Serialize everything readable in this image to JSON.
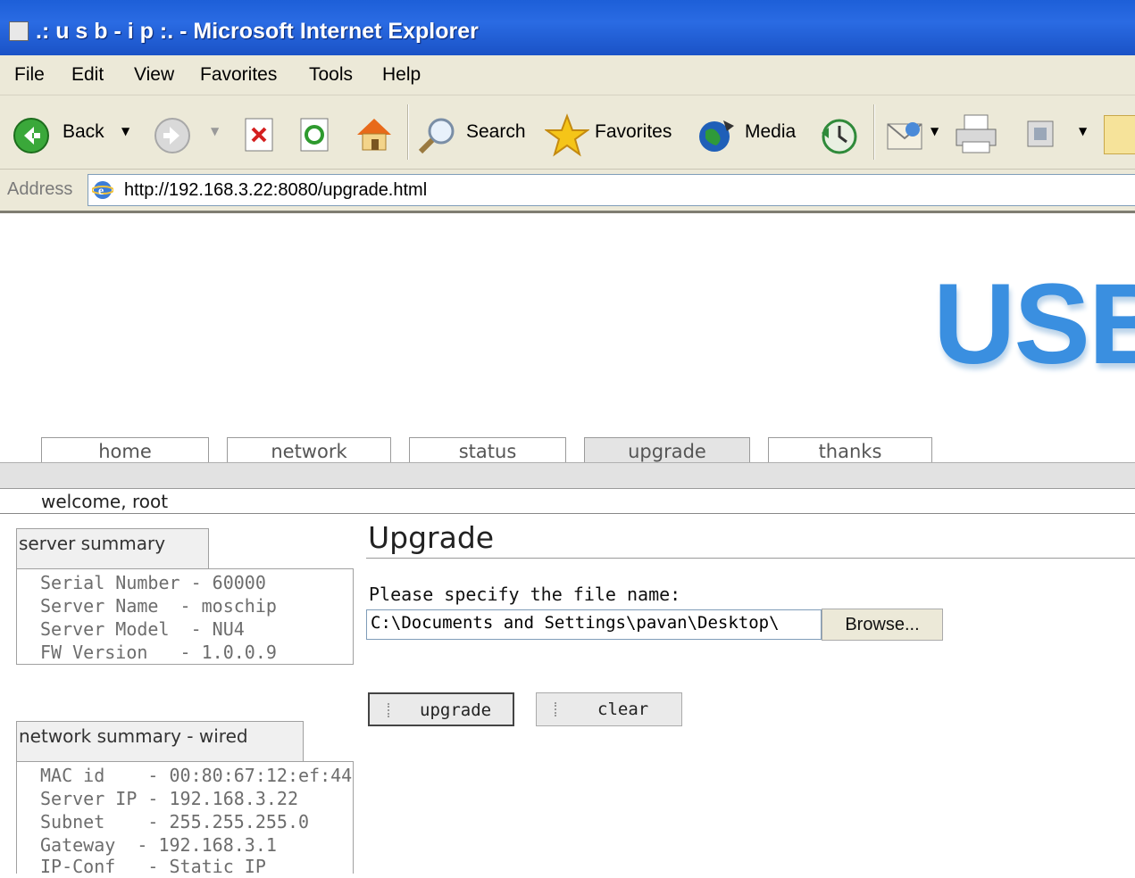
{
  "window": {
    "title": ".: u s b - i p :. - Microsoft Internet Explorer"
  },
  "menu": {
    "items": [
      "File",
      "Edit",
      "View",
      "Favorites",
      "Tools",
      "Help"
    ]
  },
  "toolbar": {
    "back_label": "Back",
    "search_label": "Search",
    "favorites_label": "Favorites",
    "media_label": "Media"
  },
  "address": {
    "label": "Address",
    "url": "http://192.168.3.22:8080/upgrade.html"
  },
  "page": {
    "logo": "USB",
    "tabs": [
      {
        "label": "home"
      },
      {
        "label": "network"
      },
      {
        "label": "status"
      },
      {
        "label": "upgrade",
        "active": true
      },
      {
        "label": "thanks"
      }
    ],
    "welcome": "welcome, root",
    "server_summary": {
      "heading": "server summary",
      "lines": [
        "Serial Number - 60000",
        "Server Name  - moschip",
        "Server Model  - NU4",
        "FW Version   - 1.0.0.9"
      ]
    },
    "network_summary": {
      "heading": "network summary - wired",
      "lines": [
        "MAC id    - 00:80:67:12:ef:44",
        "Server IP - 192.168.3.22",
        "Subnet    - 255.255.255.0",
        "Gateway  - 192.168.3.1",
        "IP-Conf   - Static IP"
      ]
    },
    "upgrade": {
      "title": "Upgrade",
      "file_label": "Please specify the file name:",
      "file_value": "C:\\Documents and Settings\\pavan\\Desktop\\",
      "browse_label": "Browse...",
      "upgrade_button": "upgrade",
      "clear_button": "clear"
    }
  },
  "colors": {
    "titlebar": "#2a6be3",
    "chrome": "#ece9d8",
    "logo": "#3a8fe0"
  }
}
